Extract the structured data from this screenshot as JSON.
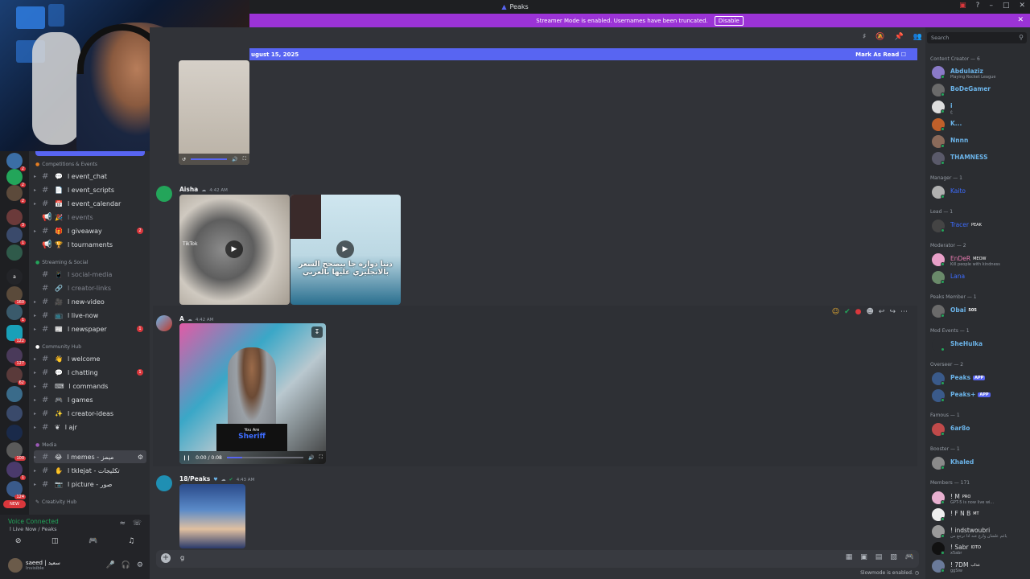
{
  "window": {
    "title": "Peaks"
  },
  "banner": {
    "text": "Streamer Mode is enabled. Usernames have been truncated.",
    "button": "Disable"
  },
  "unread_bar": {
    "date": "ugust 15, 2025",
    "mark": "Mark As Read"
  },
  "search": {
    "placeholder": "Search"
  },
  "rail": {
    "badges": [
      "2",
      "2",
      "2",
      "3",
      "1",
      "160",
      "1",
      "122",
      "127",
      "62",
      "100",
      "1",
      "124",
      "NEW"
    ],
    "letter": "a"
  },
  "channels": {
    "cat_competitions": "Competitions & Events",
    "event_chat": "l event_chat",
    "event_scripts": "l event_scripts",
    "event_calendar": "l event_calendar",
    "events": "l events",
    "giveaway": "l giveaway",
    "giveaway_badge": "2",
    "tournaments": "l tournaments",
    "cat_streaming": "Streaming & Social",
    "social_media": "l social-media",
    "creator_links": "l creator-links",
    "new_video": "l new-video",
    "live_now": "l live-now",
    "newspaper": "l newspaper",
    "newspaper_badge": "1",
    "cat_community": "Community Hub",
    "welcome": "l welcome",
    "chatting": "l chatting",
    "chatting_badge": "1",
    "commands": "l commands",
    "games": "l games",
    "creator_ideas": "l creator-ideas",
    "ajr": "l ajr",
    "cat_media": "Media",
    "memes": "l memes - ميمز",
    "tklejat": "l tklejat - تكليجات",
    "picture": "l picture - صور",
    "cat_creativity": "Creativity Hub"
  },
  "voice": {
    "status": "Voice Connected",
    "channel": "l Live Now / Peaks"
  },
  "user": {
    "name": "saeed | سعيد",
    "status": "Invisible"
  },
  "messages": {
    "aisha": {
      "author": "Aisha",
      "time": "4:42 AM",
      "overlay": "دنيا دواره جا بيصحح السعر بالانجليزي عليها بالعربي",
      "tiktok": "TikTok"
    },
    "a": {
      "author": "A",
      "time": "4:42 AM",
      "video_time": "0:00 / 0:08",
      "progress": 0.2,
      "video_caption_top": "You Are",
      "video_caption_bottom": "Sheriff"
    },
    "peaks": {
      "author": "18/Peaks",
      "time": "4:43 AM"
    }
  },
  "input": {
    "text": "g"
  },
  "slowmode": "Slowmode is enabled.",
  "members": {
    "content_creator": "Content Creator — 6",
    "abdulaziz": "Abdulaziz",
    "abdulaziz_sub": "Playing Rocket League",
    "bodegamer": "BoDeGamer",
    "i_sub": "ع",
    "i": "i",
    "k": "K...",
    "nnnn": "Nnnn",
    "thamness": "THAMNESS",
    "manager": "Manager — 1",
    "kaito": "Kaito",
    "lead": "Lead — 1",
    "tracer": "Tracer",
    "tracer_tag": "PEAK",
    "moderator": "Moderator — 2",
    "ender": "EnDeR",
    "ender_tag": "MEOW",
    "ender_sub": "Kill people with kindness",
    "lana": "Lana",
    "peaks_member": "Peaks Member — 1",
    "obai": "Obai",
    "obai_tag": "505",
    "mod_events": "Mod Events — 1",
    "shehulka": "SheHulka",
    "overseer": "Overseer — 2",
    "peaks": "Peaks",
    "peaks_plus": "Peaks+",
    "app_tag": "APP",
    "famous": "Famous — 1",
    "arbo": "6ar8o",
    "booster": "Booster — 1",
    "khaled": "Khaled",
    "members_count": "Members — 171",
    "m": "! M",
    "m_tag": "PRO",
    "m_sub": "GPT-5 is now live wi...",
    "fnb": "! F N B",
    "fnb_tag": "MT",
    "indstwoubri": "! indstwoubri",
    "indst_sub": "ياغم علشان وارغ عنه اذا ترجع من",
    "sabr": "! Sabr",
    "sabr_tag": "IDTO",
    "sabr_sub": "x5abr",
    "zdm": "! 7DM",
    "zdm_tag": "عذاب",
    "zdm_sub": "ggSiw"
  }
}
